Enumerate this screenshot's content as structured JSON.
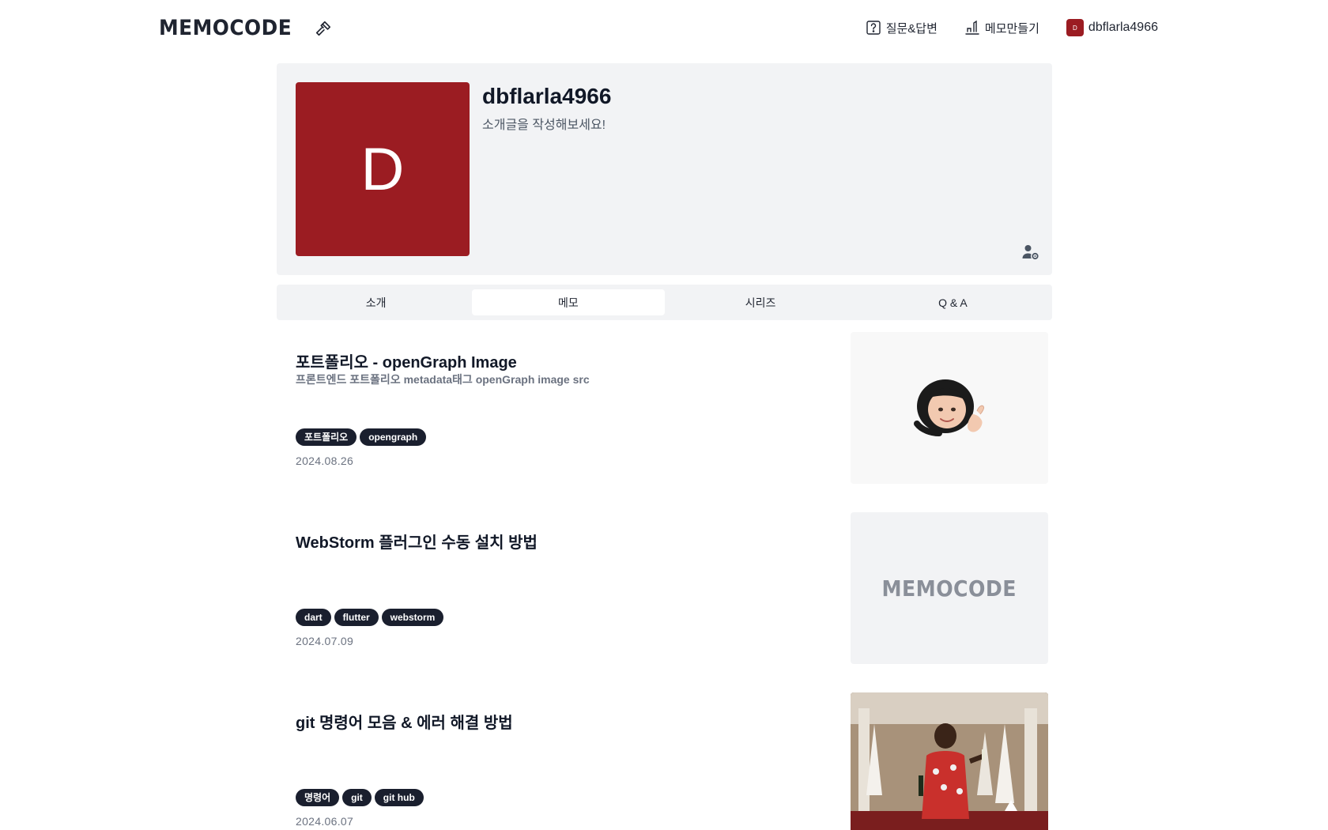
{
  "header": {
    "logo": "MEMOCODE",
    "nav": {
      "qa_label": "질문&답변",
      "create_memo_label": "메모만들기",
      "user_avatar_initial": "D",
      "username": "dbflarla4966"
    }
  },
  "profile": {
    "avatar_initial": "D",
    "avatar_color": "#9b1c22",
    "name": "dbflarla4966",
    "bio": "소개글을 작성해보세요!"
  },
  "tabs": [
    {
      "label": "소개",
      "active": false
    },
    {
      "label": "메모",
      "active": true
    },
    {
      "label": "시리즈",
      "active": false
    },
    {
      "label": "Q & A",
      "active": false
    }
  ],
  "memos": [
    {
      "title": "포트폴리오 - openGraph Image",
      "description": "프론트엔드 포트폴리오 metadata태그 openGraph image src",
      "tags": [
        "포트폴리오",
        "opengraph"
      ],
      "date": "2024.08.26",
      "thumbnail": "memoji-avatar"
    },
    {
      "title": "WebStorm 플러그인 수동 설치 방법",
      "description": "",
      "tags": [
        "dart",
        "flutter",
        "webstorm"
      ],
      "date": "2024.07.09",
      "thumbnail_text": "MEMOCODE"
    },
    {
      "title": "git 명령어 모음 & 에러 해결 방법",
      "description": "",
      "tags": [
        "명령어",
        "git",
        "git hub"
      ],
      "date": "2024.06.07",
      "thumbnail": "photo-man-celebrating"
    }
  ]
}
